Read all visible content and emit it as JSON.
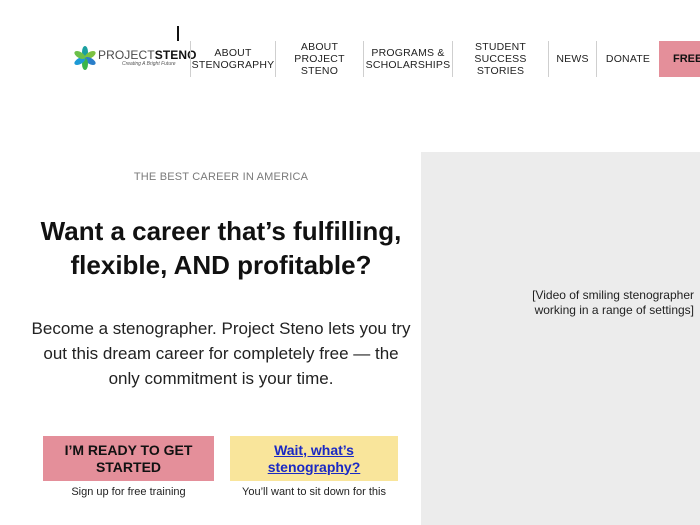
{
  "header": {
    "logo": {
      "name_part1": "PROJECT",
      "name_part2": "STENO",
      "tagline": "Creating A Bright Future"
    },
    "nav": [
      {
        "line1": "About",
        "line2": "Stenography"
      },
      {
        "line1": "About",
        "line2": "Project Steno"
      },
      {
        "line1": "Programs &",
        "line2": "Scholarships"
      },
      {
        "line1": "Student",
        "line2": "Success Stories"
      },
      {
        "line1": "News",
        "line2": ""
      },
      {
        "line1": "Donate",
        "line2": ""
      }
    ],
    "free_label": "FREE"
  },
  "hero": {
    "eyebrow": "THE BEST CAREER IN AMERICA",
    "headline_line1": "Want a career that’s fulfilling,",
    "headline_line2": "flexible, AND profitable?",
    "body_line1": "Become a stenographer. Project Steno lets you try",
    "body_line2": "out this dream career for completely free — the",
    "body_line3": "only commitment is your time.",
    "cta_primary_line1": "I’M READY TO GET",
    "cta_primary_line2": "STARTED",
    "cta_primary_note": "Sign up for free training",
    "cta_secondary_line1": "Wait, what’s",
    "cta_secondary_line2": "stenography?",
    "cta_secondary_note": "You’ll want to sit down for this"
  },
  "video": {
    "caption_line1": "[Video of smiling stenographer",
    "caption_line2": "working in a range of settings]"
  },
  "colors": {
    "primary_pink": "#e48f9a",
    "secondary_yellow": "#f9e59b",
    "link_blue": "#1a29c4",
    "placeholder_gray": "#ececec"
  }
}
